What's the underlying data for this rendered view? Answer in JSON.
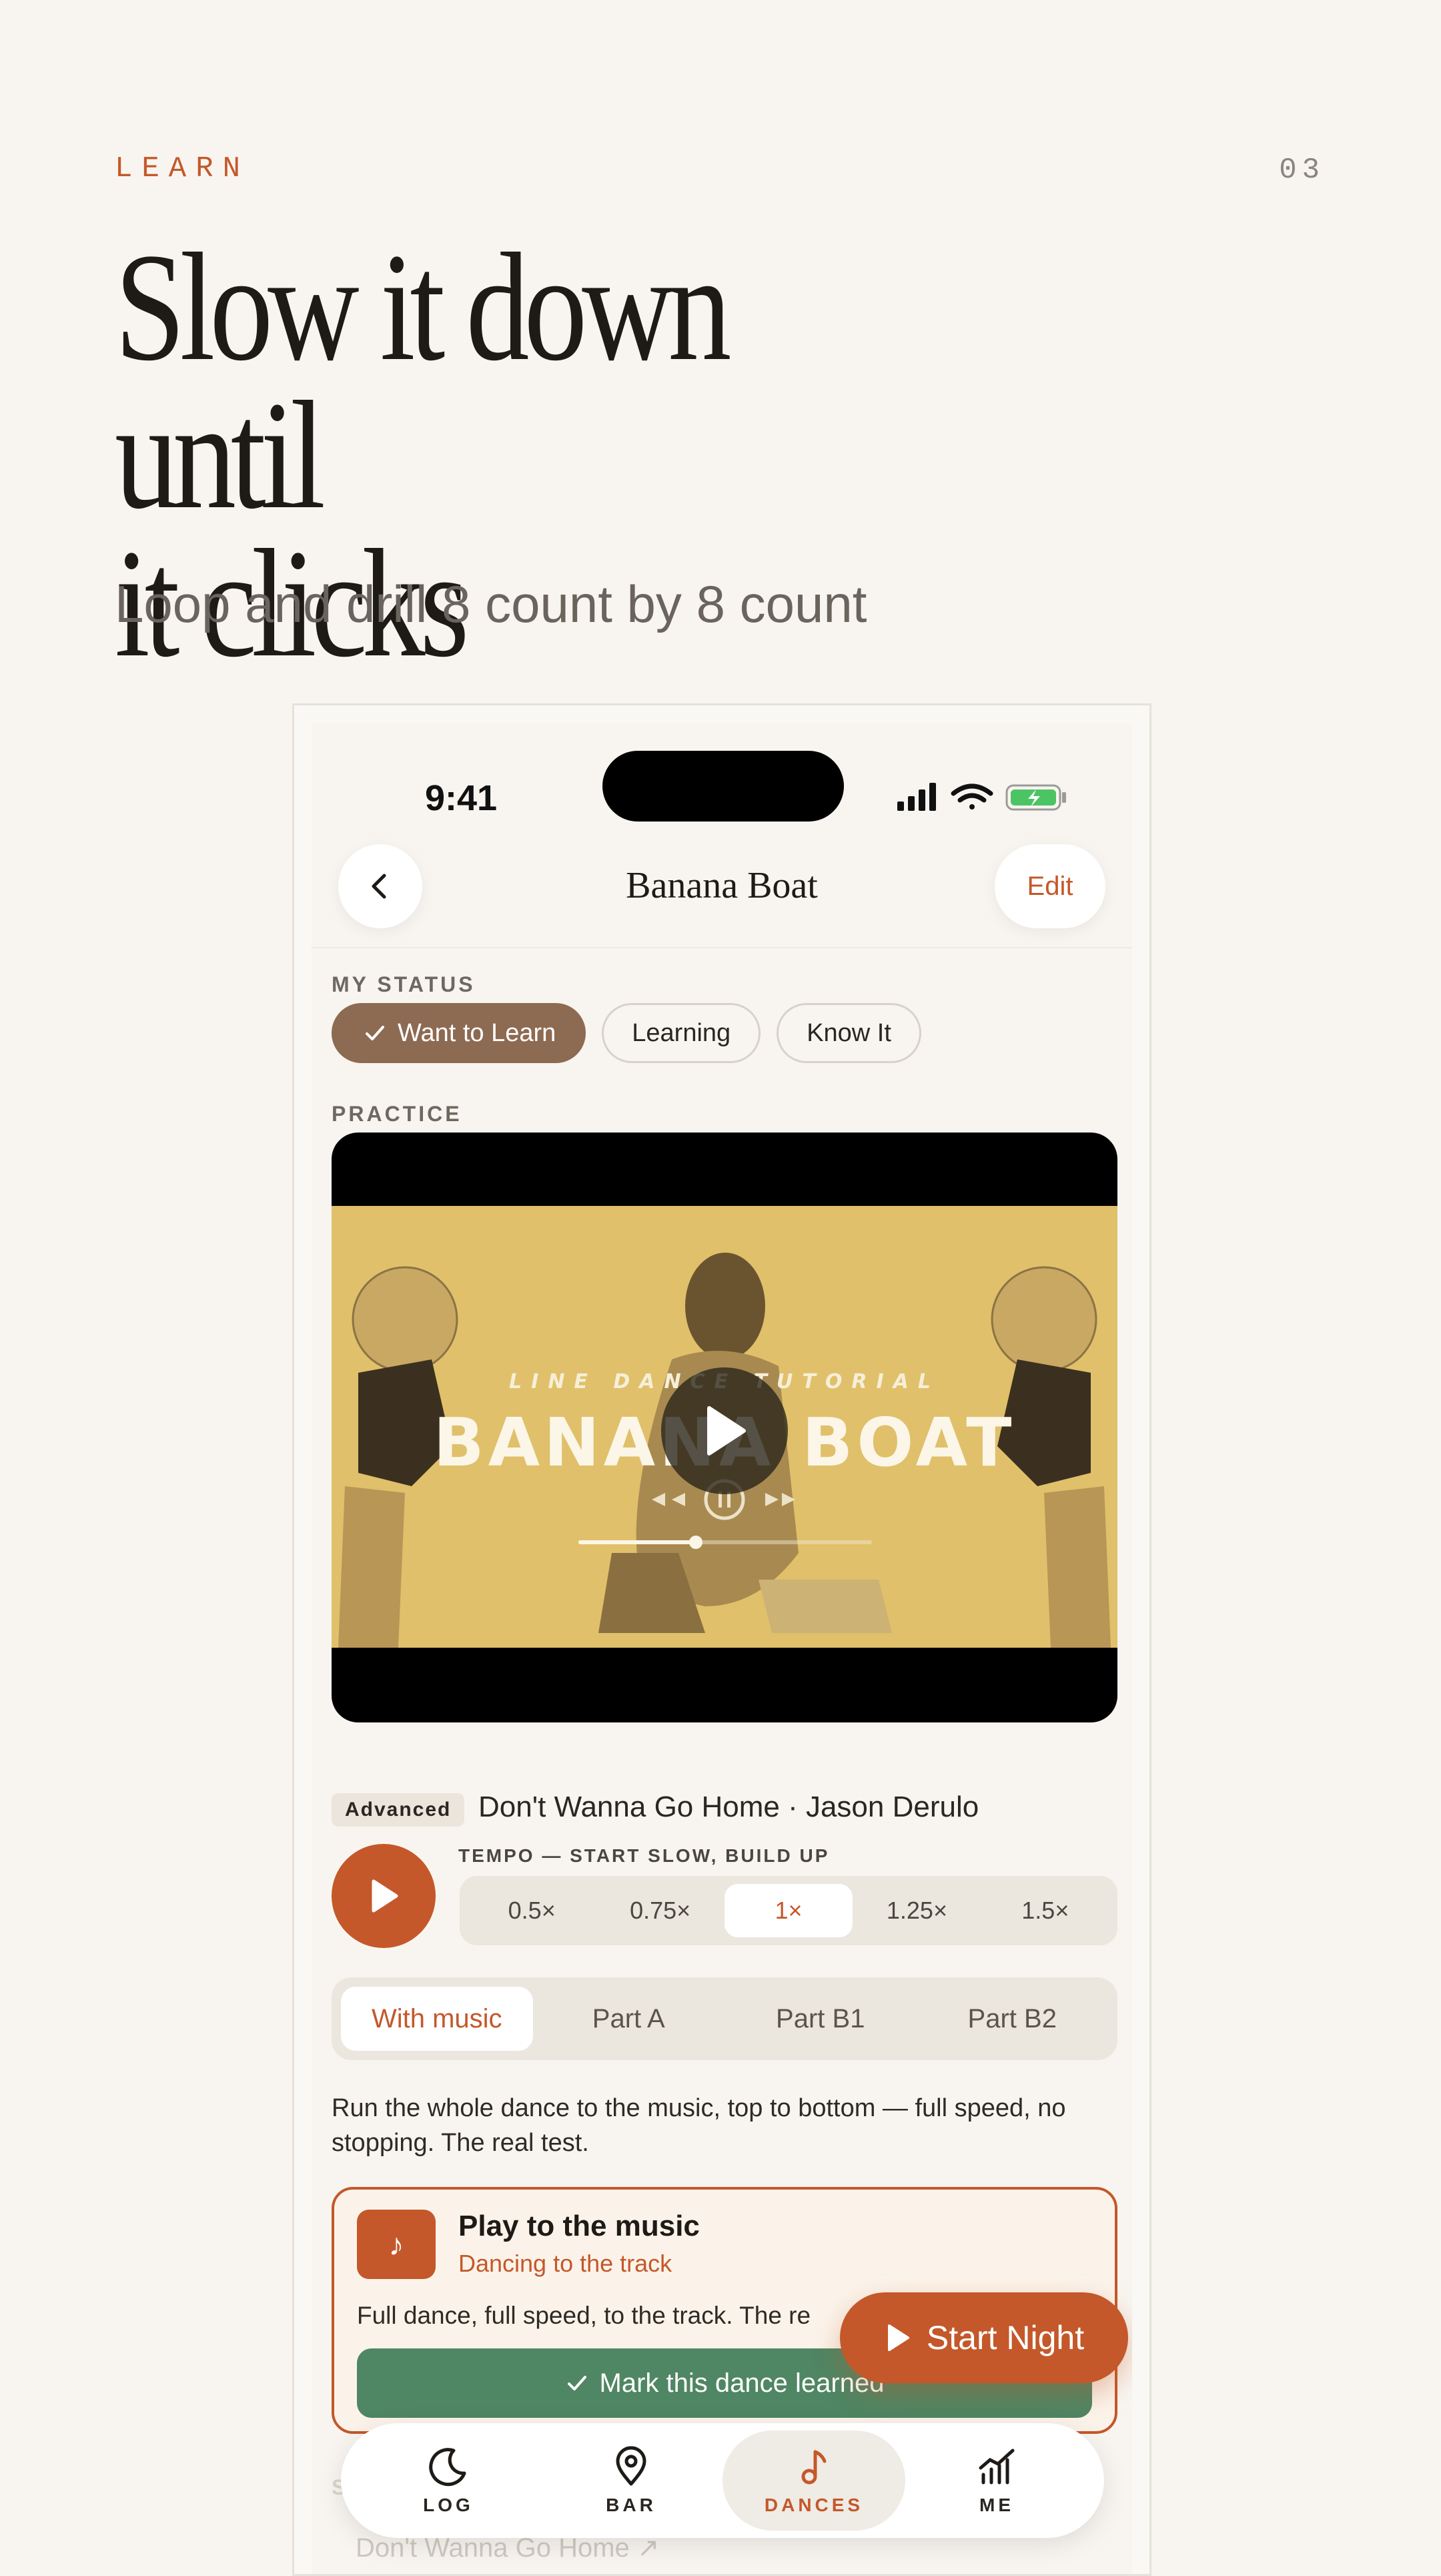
{
  "header": {
    "eyebrow": "LEARN",
    "page_number": "03",
    "headline_line1": "Slow it down until",
    "headline_line2": "it clicks",
    "subhead": "Loop and drill 8 count by 8 count"
  },
  "status_bar": {
    "time": "9:41"
  },
  "nav": {
    "title": "Banana Boat",
    "edit_label": "Edit"
  },
  "my_status": {
    "label": "MY STATUS",
    "options": [
      {
        "label": "Want to Learn",
        "selected": true
      },
      {
        "label": "Learning",
        "selected": false
      },
      {
        "label": "Know It",
        "selected": false
      }
    ]
  },
  "practice": {
    "label": "PRACTICE",
    "video": {
      "overlay_small": "LINE DANCE TUTORIAL",
      "overlay_title": "BANANA BOAT",
      "progress": 0.4
    }
  },
  "track": {
    "level": "Advanced",
    "song": "Don't Wanna Go Home · Jason Derulo"
  },
  "tempo": {
    "label": "TEMPO — START SLOW, BUILD UP",
    "options": [
      "0.5×",
      "0.75×",
      "1×",
      "1.25×",
      "1.5×"
    ],
    "selected": "1×"
  },
  "parts": {
    "options": [
      "With music",
      "Part A",
      "Part B1",
      "Part B2"
    ],
    "selected": "With music"
  },
  "description": "Run the whole dance to the music, top to bottom — full speed, no stopping. The real test.",
  "card": {
    "icon": "music-note-icon",
    "title": "Play to the music",
    "subtitle": "Dancing to the track",
    "text": "Full dance, full speed, to the track. The re",
    "mark_label": "Mark this dance learned"
  },
  "start_night": {
    "label": "Start Night"
  },
  "faded": {
    "label": "S",
    "song": "Don't Wanna Go Home ↗"
  },
  "tabbar": {
    "tabs": [
      {
        "label": "LOG",
        "icon": "moon-icon"
      },
      {
        "label": "BAR",
        "icon": "location-pin-icon"
      },
      {
        "label": "DANCES",
        "icon": "music-note-icon",
        "active": true
      },
      {
        "label": "ME",
        "icon": "stats-chart-icon"
      }
    ]
  },
  "colors": {
    "accent": "#c4582a",
    "status_selected": "#8d6a52",
    "success": "#4f8663",
    "background": "#f8f5f0"
  }
}
